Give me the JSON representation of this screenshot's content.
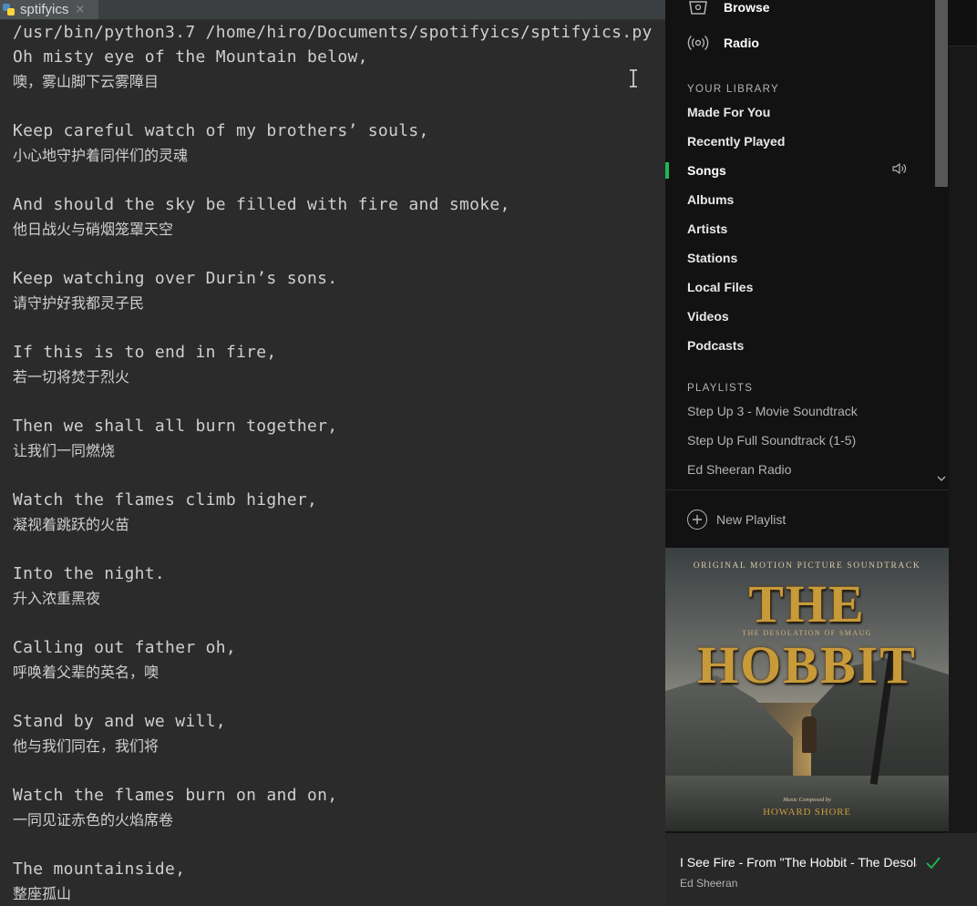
{
  "ide": {
    "tab_name": "sptifyics",
    "tab_close": "×",
    "command": "/usr/bin/python3.7 /home/hiro/Documents/spotifyics/sptifyics.py",
    "lyrics": [
      {
        "en": "Oh misty eye of the Mountain below,",
        "zh": "噢，雾山脚下云雾障目"
      },
      {
        "en": "Keep careful watch of my brothers’ souls,",
        "zh": "小心地守护着同伴们的灵魂"
      },
      {
        "en": "And should the sky be filled with fire and smoke,",
        "zh": "他日战火与硝烟笼罩天空"
      },
      {
        "en": "Keep watching over Durin’s sons.",
        "zh": "请守护好我都灵子民"
      },
      {
        "en": "If this is to end in fire,",
        "zh": "若一切将焚于烈火"
      },
      {
        "en": "Then we shall all burn together,",
        "zh": "让我们一同燃烧"
      },
      {
        "en": "Watch the flames climb higher,",
        "zh": "凝视着跳跃的火苗"
      },
      {
        "en": "Into the night.",
        "zh": "升入浓重黑夜"
      },
      {
        "en": "Calling out father oh,",
        "zh": "呼唤着父辈的英名，噢"
      },
      {
        "en": "Stand by and we will,",
        "zh": "他与我们同在，我们将"
      },
      {
        "en": "Watch the flames burn on and on,",
        "zh": "一同见证赤色的火焰席卷"
      },
      {
        "en": "The mountainside,",
        "zh": "整座孤山"
      }
    ]
  },
  "spotify": {
    "nav": {
      "browse": {
        "label": "Browse",
        "icon": "browse-icon"
      },
      "radio": {
        "label": "Radio",
        "icon": "radio-icon"
      }
    },
    "library_heading": "YOUR LIBRARY",
    "library": [
      "Made For You",
      "Recently Played",
      "Songs",
      "Albums",
      "Artists",
      "Stations",
      "Local Files",
      "Videos",
      "Podcasts"
    ],
    "active_library_item": "Songs",
    "playlists_heading": "PLAYLISTS",
    "playlists": [
      "Step Up 3 - Movie Soundtrack",
      "Step Up Full Soundtrack (1-5)",
      "Ed Sheeran Radio"
    ],
    "new_playlist": "New Playlist",
    "album_art": {
      "top_text": "ORIGINAL MOTION PICTURE SOUNDTRACK",
      "title": "THE HOBBIT",
      "subtitle": "THE DESOLATION OF SMAUG",
      "composer_prefix": "Music Composed by",
      "composer": "HOWARD SHORE"
    },
    "now_playing": {
      "title": "I See Fire - From \"The Hobbit - The Desolation Of Smaug\"",
      "artist": "Ed Sheeran",
      "saved": true
    },
    "colors": {
      "accent": "#1db954",
      "background": "#121212",
      "now_playing_bg": "#282828"
    }
  }
}
